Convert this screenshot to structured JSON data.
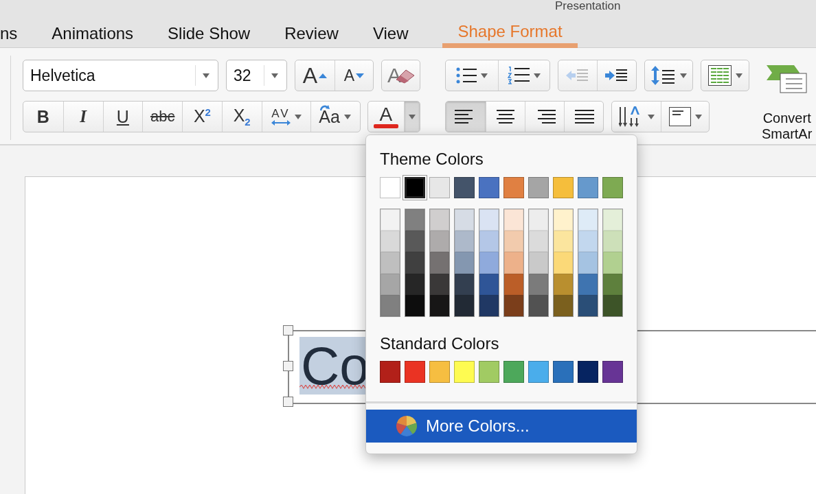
{
  "window": {
    "title": "Presentation"
  },
  "tabs": [
    {
      "label": "ns",
      "selected": false
    },
    {
      "label": "Animations",
      "selected": false
    },
    {
      "label": "Slide Show",
      "selected": false
    },
    {
      "label": "Review",
      "selected": false
    },
    {
      "label": "View",
      "selected": false
    },
    {
      "label": "Shape Format",
      "selected": true
    }
  ],
  "font": {
    "name": "Helvetica",
    "size": "32"
  },
  "size_buttons": [
    {
      "kind": "grow",
      "label": "A"
    },
    {
      "kind": "shrink",
      "label": "A"
    }
  ],
  "clear_formatting": {
    "label": "A"
  },
  "format_buttons": [
    {
      "kind": "bold",
      "label": "B"
    },
    {
      "kind": "italic",
      "label": "I"
    },
    {
      "kind": "underline",
      "label": "U"
    },
    {
      "kind": "strike",
      "label": "abc"
    },
    {
      "kind": "superscript",
      "label": "X$^{2}$"
    },
    {
      "kind": "subscript",
      "label": "X$_{2}$"
    },
    {
      "kind": "spacing",
      "label": "AV"
    },
    {
      "kind": "case",
      "label": "Aa"
    }
  ],
  "font_color": {
    "label": "A",
    "color": "#e0281f",
    "expanded": true
  },
  "alignment": [
    {
      "kind": "left",
      "selected": true
    },
    {
      "kind": "center",
      "selected": false
    },
    {
      "kind": "right",
      "selected": false
    },
    {
      "kind": "justify",
      "selected": false
    }
  ],
  "convert": {
    "label": "Convert\nSmartAr"
  },
  "slide": {
    "text": "Co",
    "selected": true
  },
  "color_menu": {
    "theme_title": "Theme Colors",
    "theme_colors": [
      {
        "color": "#ffffff",
        "selected": false,
        "shades": [
          {
            "color": "#f2f2f2"
          },
          {
            "color": "#d9d9d9"
          },
          {
            "color": "#bfbfbf"
          },
          {
            "color": "#a6a6a6"
          },
          {
            "color": "#808080"
          }
        ]
      },
      {
        "color": "#000000",
        "selected": true,
        "shades": [
          {
            "color": "#808080"
          },
          {
            "color": "#595959"
          },
          {
            "color": "#404040"
          },
          {
            "color": "#262626"
          },
          {
            "color": "#0d0d0d"
          }
        ]
      },
      {
        "color": "#e7e7e7",
        "selected": false,
        "shades": [
          {
            "color": "#d0cece"
          },
          {
            "color": "#aeabab"
          },
          {
            "color": "#757171"
          },
          {
            "color": "#3a3838"
          },
          {
            "color": "#171616"
          }
        ]
      },
      {
        "color": "#44546a",
        "selected": false,
        "shades": [
          {
            "color": "#d6dce5"
          },
          {
            "color": "#adb9ca"
          },
          {
            "color": "#8497b0"
          },
          {
            "color": "#333f50"
          },
          {
            "color": "#222a35"
          }
        ]
      },
      {
        "color": "#4a72c0",
        "selected": false,
        "shades": [
          {
            "color": "#dae3f3"
          },
          {
            "color": "#b4c7e7"
          },
          {
            "color": "#8faadc"
          },
          {
            "color": "#2f5597"
          },
          {
            "color": "#203864"
          }
        ]
      },
      {
        "color": "#e08042",
        "selected": false,
        "shades": [
          {
            "color": "#fbe5d6"
          },
          {
            "color": "#f2cbad"
          },
          {
            "color": "#edb18a"
          },
          {
            "color": "#bb5e28"
          },
          {
            "color": "#7b3e1b"
          }
        ]
      },
      {
        "color": "#a5a5a5",
        "selected": false,
        "shades": [
          {
            "color": "#ededed"
          },
          {
            "color": "#dbdbdb"
          },
          {
            "color": "#c9c9c9"
          },
          {
            "color": "#7b7b7b"
          },
          {
            "color": "#525252"
          }
        ]
      },
      {
        "color": "#f5be3c",
        "selected": false,
        "shades": [
          {
            "color": "#fff2cc"
          },
          {
            "color": "#fbe59e"
          },
          {
            "color": "#fbd978"
          },
          {
            "color": "#b98f2f"
          },
          {
            "color": "#7b601e"
          }
        ]
      },
      {
        "color": "#6699cc",
        "selected": false,
        "shades": [
          {
            "color": "#deebf7"
          },
          {
            "color": "#c2d7ee"
          },
          {
            "color": "#a5c3e2"
          },
          {
            "color": "#3f74b0"
          },
          {
            "color": "#2a4e77"
          }
        ]
      },
      {
        "color": "#7eaa52",
        "selected": false,
        "shades": [
          {
            "color": "#e4efd9"
          },
          {
            "color": "#cde0b9"
          },
          {
            "color": "#b1d090"
          },
          {
            "color": "#5e803d"
          },
          {
            "color": "#3d5428"
          }
        ]
      }
    ],
    "standard_title": "Standard Colors",
    "standard_colors": [
      {
        "color": "#b22019"
      },
      {
        "color": "#ea3323"
      },
      {
        "color": "#f6be41"
      },
      {
        "color": "#fefb51"
      },
      {
        "color": "#a1cb63"
      },
      {
        "color": "#4da85b"
      },
      {
        "color": "#4aadeb"
      },
      {
        "color": "#2a70ba"
      },
      {
        "color": "#062461"
      },
      {
        "color": "#673495"
      }
    ],
    "more_item": {
      "label": "More Colors...",
      "highlighted": true
    }
  }
}
